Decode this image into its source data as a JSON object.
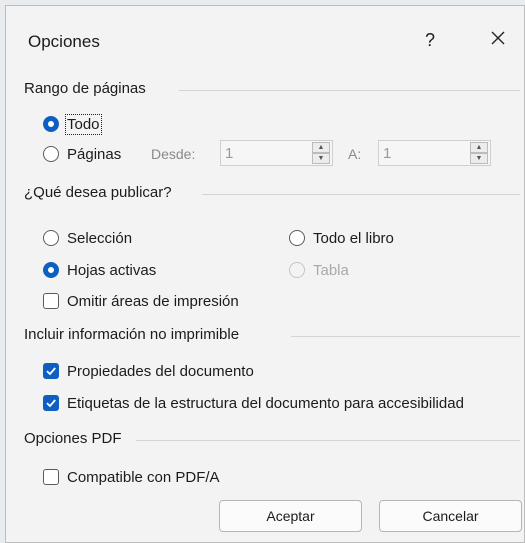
{
  "dialog": {
    "title": "Opciones",
    "help_label": "?",
    "close_icon": "close-icon"
  },
  "page_range": {
    "heading": "Rango de páginas",
    "all_label": "Todo",
    "pages_label": "Páginas",
    "from_label": "Desde:",
    "from_value": "1",
    "to_label": "A:",
    "to_value": "1",
    "selected": "all"
  },
  "publish": {
    "heading": "¿Qué desea publicar?",
    "selection_label": "Selección",
    "workbook_label": "Todo el libro",
    "active_sheets_label": "Hojas activas",
    "table_label": "Tabla",
    "ignore_print_areas_label": "Omitir áreas de impresión",
    "selected": "active_sheets",
    "ignore_print_areas": false
  },
  "nonprint": {
    "heading": "Incluir información no imprimible",
    "doc_props_label": "Propiedades del documento",
    "doc_props_checked": true,
    "struct_tags_label": "Etiquetas de la estructura del documento para accesibilidad",
    "struct_tags_checked": true
  },
  "pdf": {
    "heading": "Opciones PDF",
    "pdfa_label": "Compatible con PDF/A",
    "pdfa_checked": false
  },
  "buttons": {
    "ok_label": "Aceptar",
    "cancel_label": "Cancelar"
  },
  "colors": {
    "accent": "#0f5fc2",
    "dialog_bg": "#f3f3f3"
  }
}
